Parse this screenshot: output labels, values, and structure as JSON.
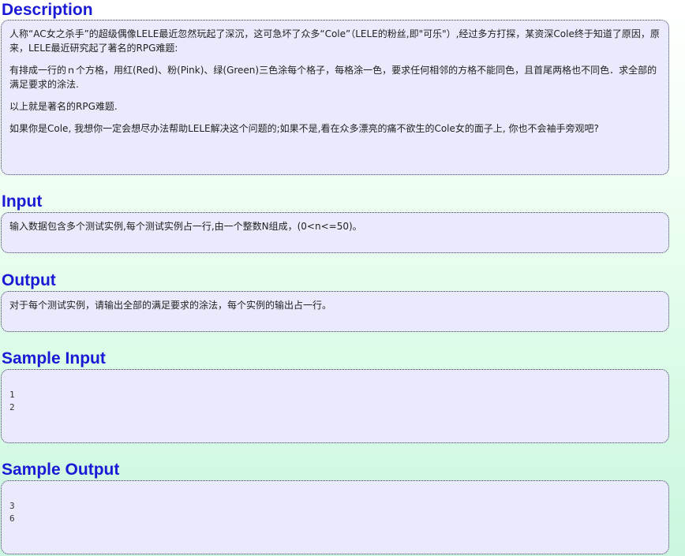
{
  "description": {
    "title": "Description",
    "paragraphs": [
      "人称“AC女之杀手”的超级偶像LELE最近忽然玩起了深沉，这可急坏了众多“Cole”（LELE的粉丝,即\"可乐\"）,经过多方打探，某资深Cole终于知道了原因，原来，LELE最近研究起了著名的RPG难题:",
      "有排成一行的ｎ个方格，用红(Red)、粉(Pink)、绿(Green)三色涂每个格子，每格涂一色，要求任何相邻的方格不能同色，且首尾两格也不同色．求全部的满足要求的涂法.",
      "以上就是著名的RPG难题.",
      "如果你是Cole, 我想你一定会想尽办法帮助LELE解决这个问题的;如果不是,看在众多漂亮的痛不欲生的Cole女的面子上, 你也不会袖手旁观吧?"
    ]
  },
  "input": {
    "title": "Input",
    "text": "输入数据包含多个测试实例,每个测试实例占一行,由一个整数N组成，(0<n<=50)。"
  },
  "output": {
    "title": "Output",
    "text": "对于每个测试实例，请输出全部的满足要求的涂法，每个实例的输出占一行。"
  },
  "sample_input": {
    "title": "Sample Input",
    "lines": [
      "1",
      "2"
    ]
  },
  "sample_output": {
    "title": "Sample Output",
    "lines": [
      "3",
      "6"
    ]
  }
}
